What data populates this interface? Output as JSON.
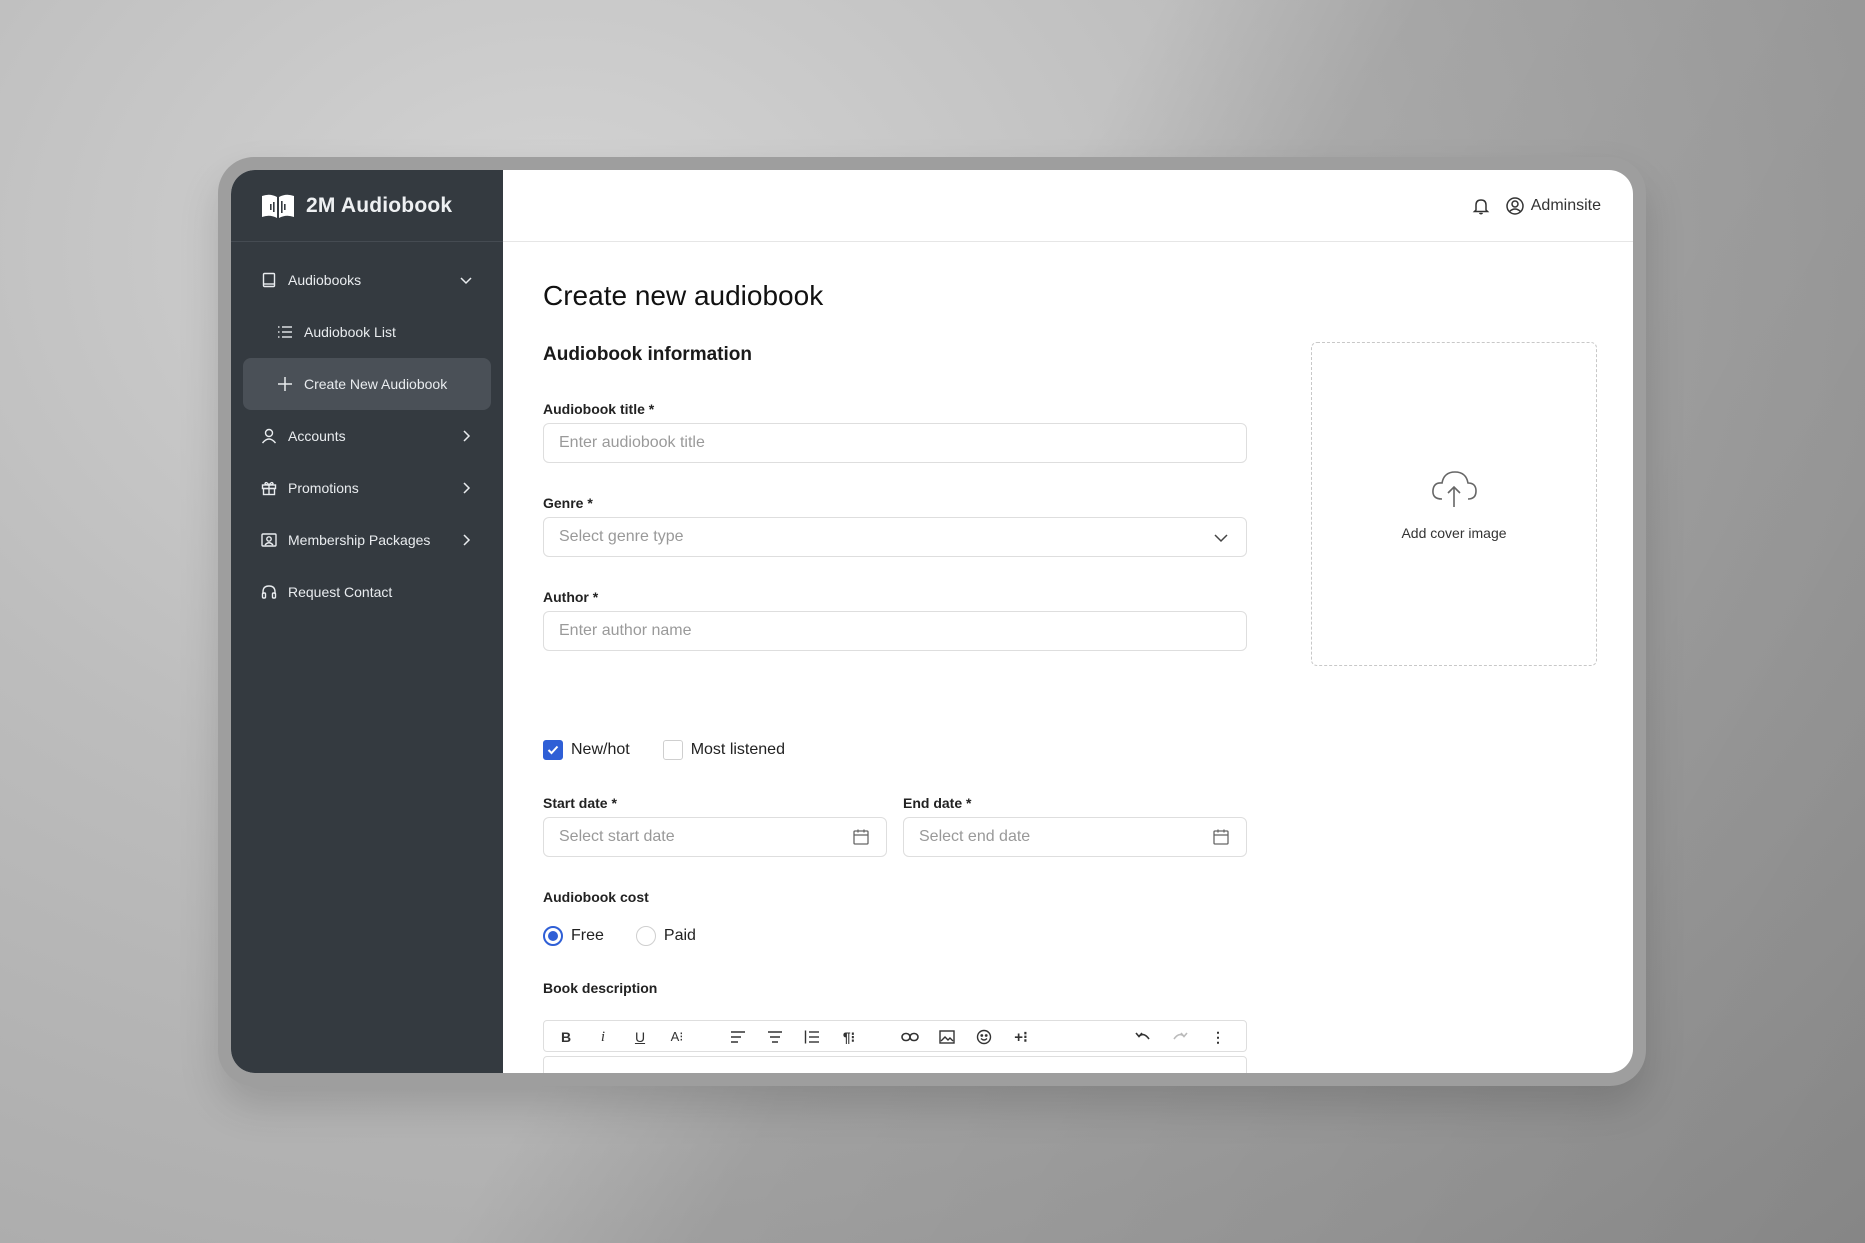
{
  "brand": {
    "name": "2M Audiobook"
  },
  "sidebar": {
    "items": [
      {
        "label": "Audiobooks"
      },
      {
        "label": "Audiobook List"
      },
      {
        "label": "Create New Audiobook"
      },
      {
        "label": "Accounts"
      },
      {
        "label": "Promotions"
      },
      {
        "label": "Membership Packages"
      },
      {
        "label": "Request Contact"
      }
    ]
  },
  "header": {
    "username": "Adminsite"
  },
  "page": {
    "title": "Create new audiobook",
    "section_title": "Audiobook information"
  },
  "form": {
    "title_label": "Audiobook title *",
    "title_placeholder": "Enter audiobook title",
    "genre_label": "Genre *",
    "genre_placeholder": "Select genre type",
    "author_label": "Author *",
    "author_placeholder": "Enter author name",
    "new_hot_label": "New/hot",
    "most_listened_label": "Most listened",
    "start_date_label": "Start date *",
    "start_date_placeholder": "Select start date",
    "end_date_label": "End date *",
    "end_date_placeholder": "Select end date",
    "cost_label": "Audiobook cost",
    "free_label": "Free",
    "paid_label": "Paid",
    "description_label": "Book description"
  },
  "cover": {
    "label": "Add cover image"
  },
  "colors": {
    "sidebar": "#343a40",
    "accent": "#2f5fd6",
    "active": "#4a5057"
  }
}
